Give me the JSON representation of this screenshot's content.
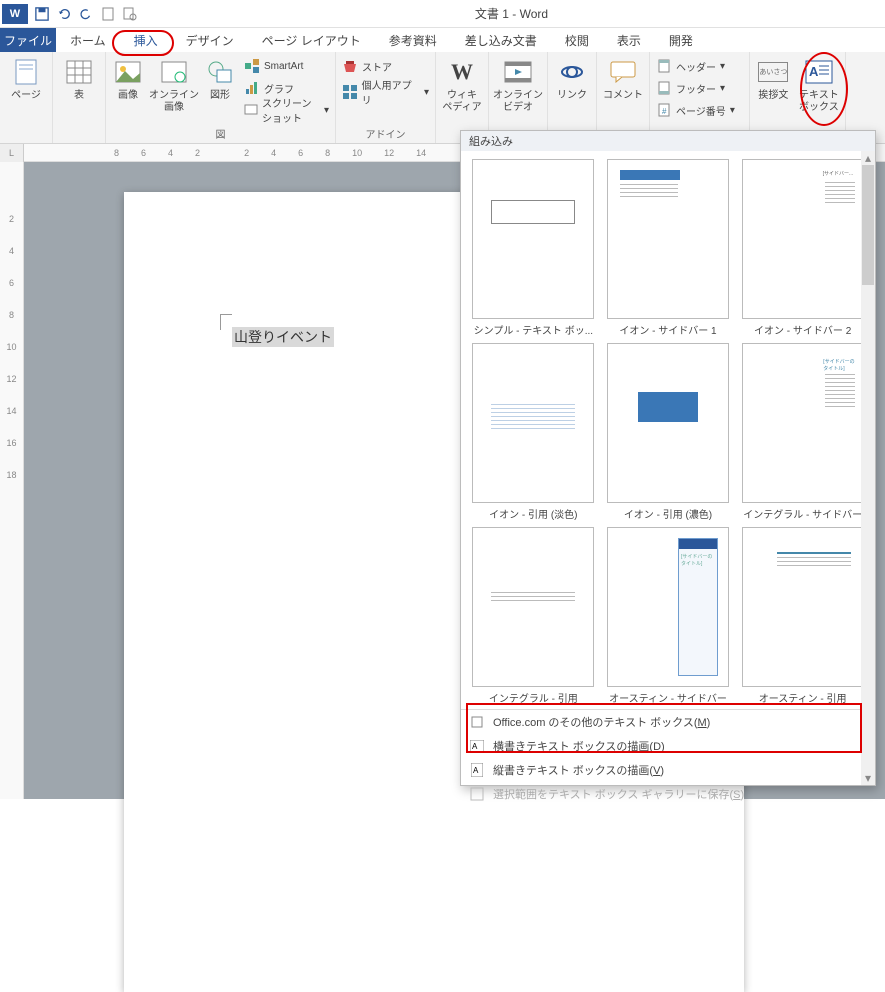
{
  "title": "文書 1 - Word",
  "tabs": {
    "file": "ファイル",
    "home": "ホーム",
    "insert": "挿入",
    "design": "デザイン",
    "layout": "ページ レイアウト",
    "references": "参考資料",
    "mailings": "差し込み文書",
    "review": "校閲",
    "view": "表示",
    "developer": "開発"
  },
  "ribbon": {
    "pages": {
      "label": "ページ",
      "group_label": ""
    },
    "tables": {
      "label": "表",
      "group_label": ""
    },
    "illustrations": {
      "picture": "画像",
      "online_pic": "オンライン\n画像",
      "shapes": "図形",
      "smartart": "SmartArt",
      "chart": "グラフ",
      "screenshot": "スクリーンショット",
      "group_label": "図"
    },
    "addins": {
      "store": "ストア",
      "myapps": "個人用アプリ",
      "group_label": "アドイン"
    },
    "media": {
      "wiki": "ウィキ\nペディア",
      "online_video": "オンライン\nビデオ"
    },
    "links": {
      "label": "リンク"
    },
    "comment": {
      "label": "コメント"
    },
    "header_footer": {
      "header": "ヘッダー",
      "footer": "フッター",
      "pagenum": "ページ番号"
    },
    "text": {
      "greeting": "挨拶文",
      "textbox": "テキスト\nボックス"
    }
  },
  "ruler_h": [
    "8",
    "6",
    "4",
    "2",
    "",
    "2",
    "4",
    "6",
    "8",
    "10",
    "12",
    "14"
  ],
  "ruler_v": [
    "",
    "2",
    "4",
    "6",
    "8",
    "10",
    "12",
    "14",
    "16",
    "18"
  ],
  "ruler_corner": "L",
  "doc": {
    "body_text": "山登りイベント"
  },
  "gallery": {
    "header": "組み込み",
    "items": [
      "シンプル - テキスト ボッ...",
      "イオン - サイドバー 1",
      "イオン - サイドバー 2",
      "イオン - 引用 (淡色)",
      "イオン - 引用 (濃色)",
      "インテグラル - サイドバー",
      "インテグラル - 引用",
      "オースティン - サイドバー",
      "オースティン - 引用"
    ],
    "more_office": "Office.com のその他のテキスト ボックス(M)",
    "draw_h": "横書きテキスト ボックスの描画(D)",
    "draw_v": "縦書きテキスト ボックスの描画(V)",
    "save_selection": "選択範囲をテキスト ボックス ギャラリーに保存(S)"
  },
  "doc_greeting_small": "あいさつ"
}
